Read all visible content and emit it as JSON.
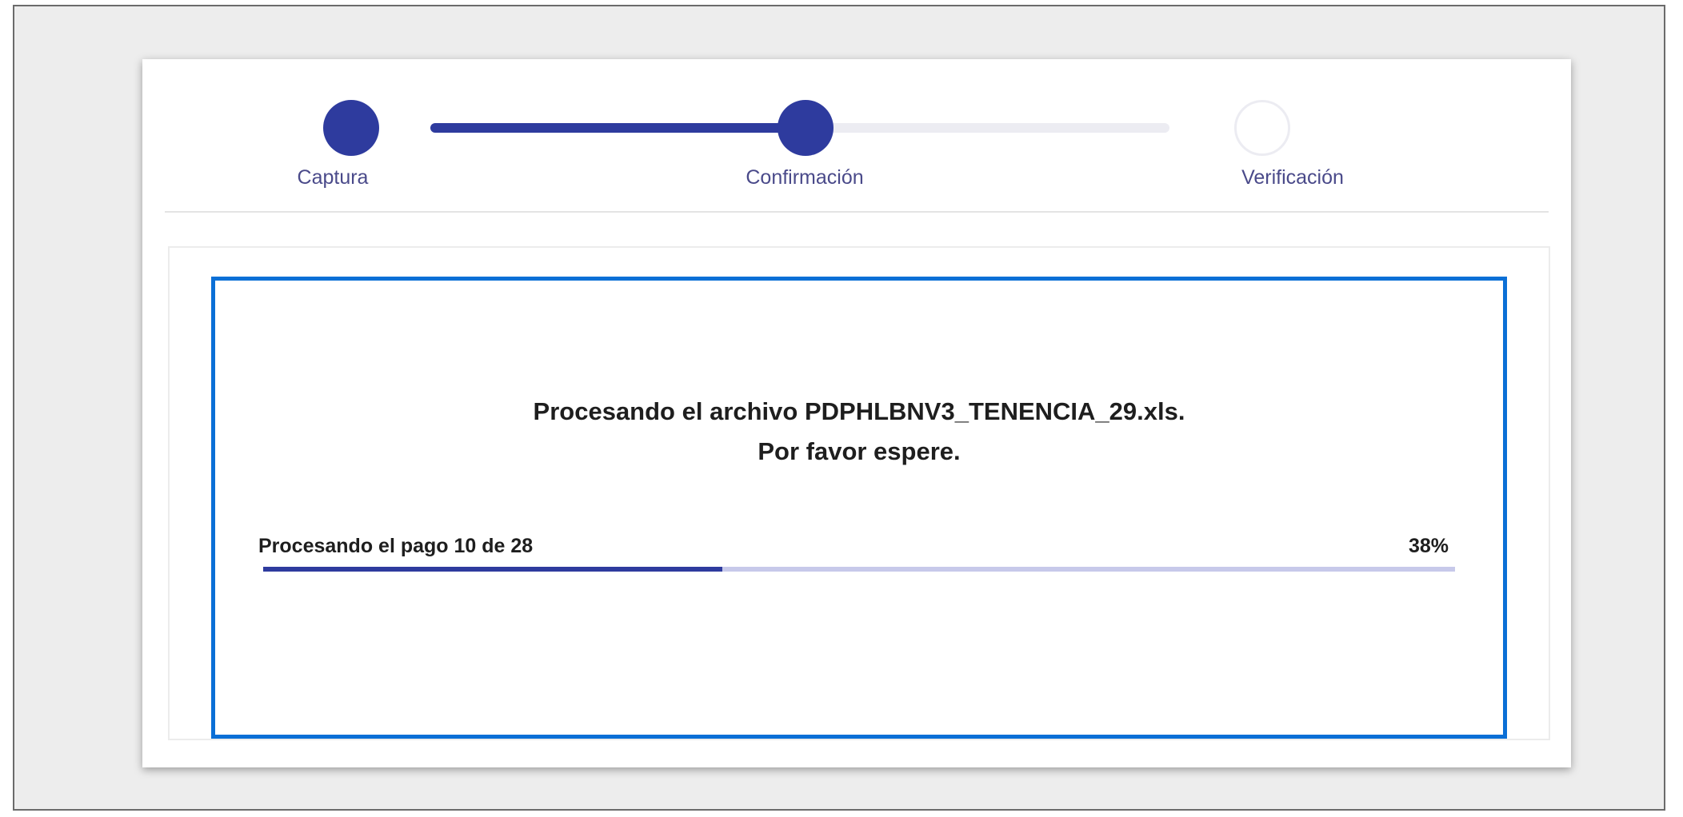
{
  "stepper": {
    "steps": [
      {
        "label": "Captura",
        "state": "done"
      },
      {
        "label": "Confirmación",
        "state": "done"
      },
      {
        "label": "Verificación",
        "state": "pending"
      }
    ]
  },
  "processing": {
    "message_line1": "Procesando el archivo PDPHLBNV3_TENENCIA_29.xls.",
    "message_line2": "Por favor espere.",
    "progress_label": "Procesando el pago 10 de 28",
    "progress_percent_text": "38%",
    "progress_fraction": 0.385
  },
  "colors": {
    "accent": "#2e3b9e",
    "highlight_border": "#0b6fd6"
  }
}
